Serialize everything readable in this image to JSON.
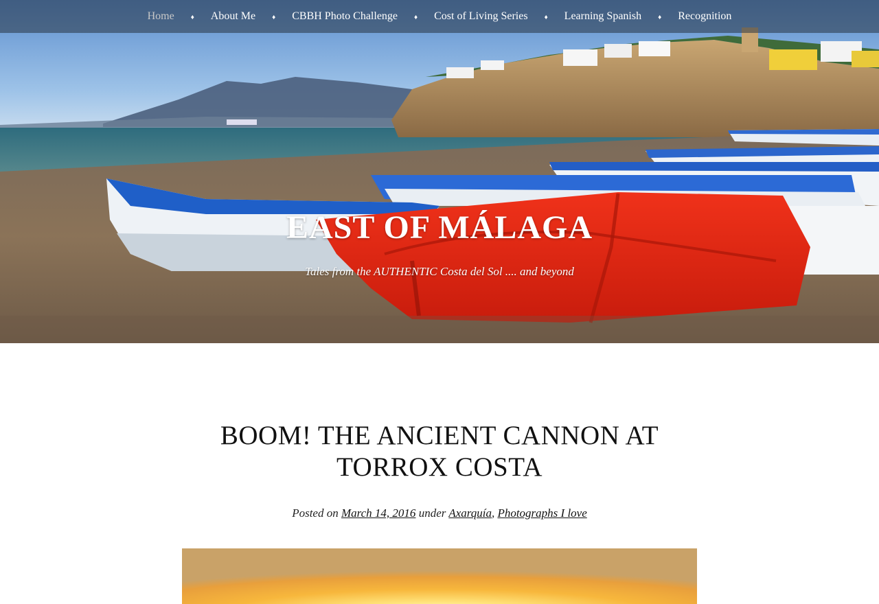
{
  "nav": {
    "items": [
      {
        "label": "Home",
        "current": true
      },
      {
        "label": "About Me"
      },
      {
        "label": "CBBH Photo Challenge"
      },
      {
        "label": "Cost of Living Series"
      },
      {
        "label": "Learning Spanish"
      },
      {
        "label": "Recognition"
      }
    ],
    "separator": "♦"
  },
  "site": {
    "title": "EAST OF MÁLAGA",
    "description": "Tales from the AUTHENTIC Costa del Sol .... and beyond"
  },
  "post": {
    "title": "BOOM! THE ANCIENT CANNON AT TORROX COSTA",
    "meta": {
      "posted_on_label": "Posted on",
      "date": "March 14, 2016",
      "under_label": "under",
      "categories": [
        "Axarquía",
        "Photographs I love"
      ],
      "category_separator": ","
    }
  },
  "colors": {
    "nav_background": "#283444",
    "boat_blue": "#1f5fc8",
    "boat_red": "#e0240f",
    "sand": "#8c7456",
    "sea": "#3f6f80",
    "sky": "#7fb0e0"
  },
  "images": {
    "header": "beach-boats-photo",
    "featured": "sunset-photo"
  }
}
